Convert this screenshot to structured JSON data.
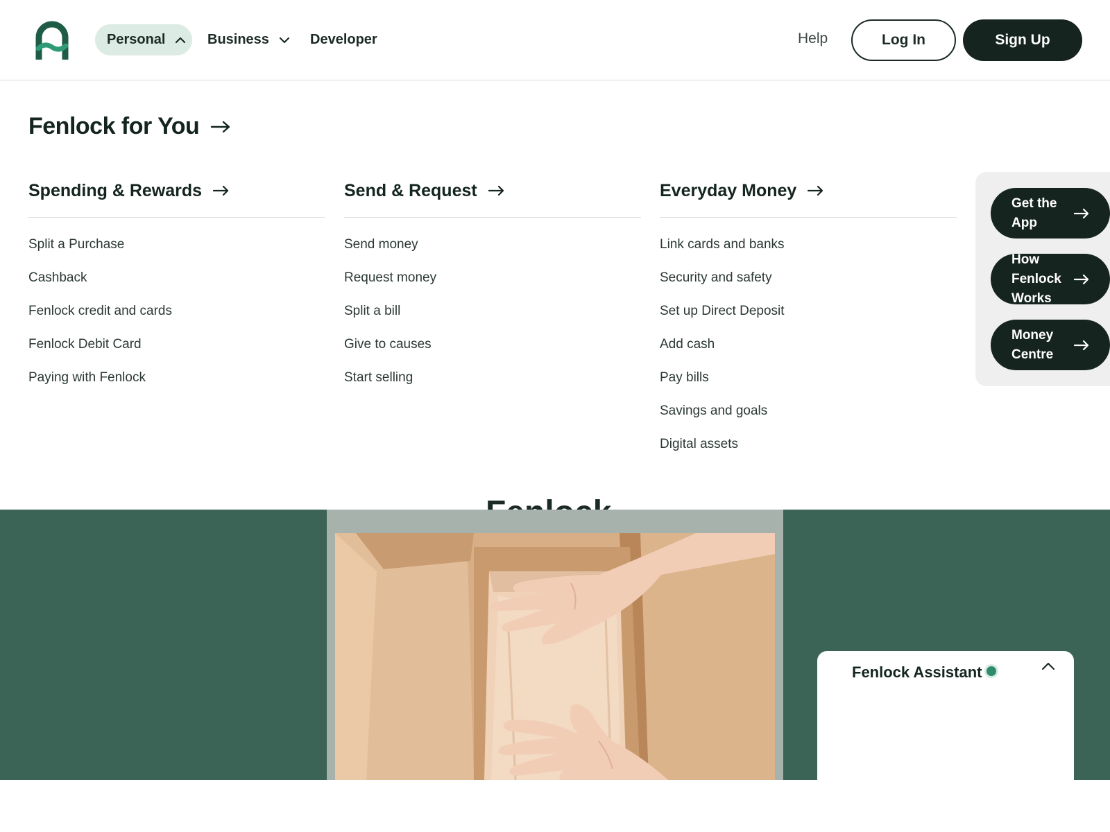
{
  "header": {
    "nav": [
      {
        "label": "Personal",
        "state": "expanded"
      },
      {
        "label": "Business",
        "state": "collapsed"
      },
      {
        "label": "Developer"
      }
    ],
    "help": "Help",
    "login": "Log In",
    "signup": "Sign Up"
  },
  "menu": {
    "title": "Fenlock for You",
    "columns": [
      {
        "heading": "Spending & Rewards",
        "items": [
          "Split a Purchase",
          "Cashback",
          "Fenlock credit and cards",
          "Fenlock Debit Card",
          "Paying with Fenlock"
        ]
      },
      {
        "heading": "Send & Request",
        "items": [
          "Send money",
          "Request money",
          "Split a bill",
          "Give to causes",
          "Start selling"
        ]
      },
      {
        "heading": "Everyday Money",
        "items": [
          "Link cards and banks",
          "Security and safety",
          "Set up Direct Deposit",
          "Add cash",
          "Pay bills",
          "Savings and goals",
          "Digital assets"
        ]
      }
    ],
    "side": [
      "Get the App",
      "How Fenlock Works",
      "Money Centre"
    ]
  },
  "hero": {
    "partial_heading": "Fenlock"
  },
  "assistant": {
    "title": "Fenlock Assistant",
    "status_color": "#2e8b6b"
  },
  "colors": {
    "brand_dark": "#15241f",
    "brand_green": "#3b6356",
    "pill_bg": "#dcebe4",
    "logo_green": "#1e5c45",
    "logo_teal": "#2f9a78"
  },
  "icons": {
    "logo": "fenlock-logo-icon",
    "arrow": "arrow-right-icon",
    "chevron_up": "chevron-up-icon",
    "chevron_down": "chevron-down-icon"
  }
}
